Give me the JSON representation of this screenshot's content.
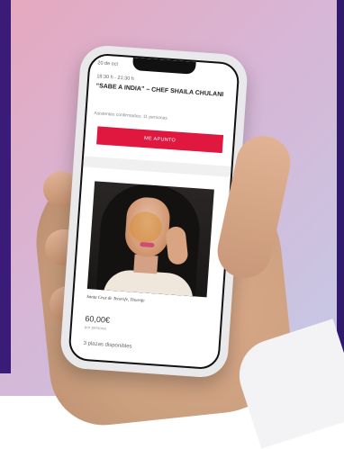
{
  "event": {
    "date": "20 de oct",
    "time": "18:30 h - 21:30 h",
    "title": "“SABE A INDIA” – CHEF SHAILA CHULANI",
    "confirmed": "Asistentes confirmados: 11 personas",
    "cta_label": "ME APUNTO",
    "location": "Santa Cruz de Tenerife, Tenerife",
    "price": "60,00€",
    "price_unit": "por persona",
    "availability": "3 plazas disponibles"
  },
  "colors": {
    "accent": "#e0173f",
    "background_left": "#3a1c78"
  }
}
